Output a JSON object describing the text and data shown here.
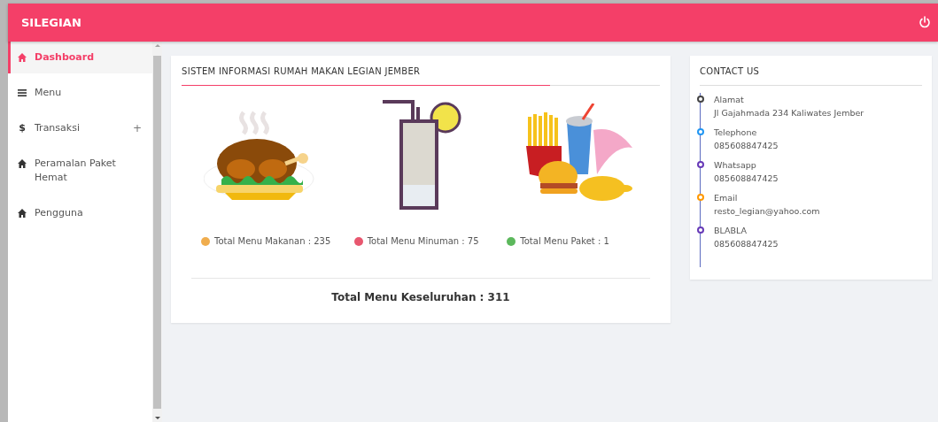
{
  "header": {
    "title": "SILEGIAN"
  },
  "sidebar": {
    "items": [
      {
        "label": "Dashboard",
        "kind": "home",
        "selected": true
      },
      {
        "label": "Menu",
        "kind": "bars",
        "selected": false
      },
      {
        "label": "Transaksi",
        "kind": "symbol",
        "symbol": "$",
        "selected": false,
        "expand_mark": "+"
      },
      {
        "label": "Peramalan Paket Hemat",
        "kind": "home",
        "selected": false
      },
      {
        "label": "Pengguna",
        "kind": "home",
        "selected": false
      }
    ]
  },
  "dashboard": {
    "title": "SISTEM INFORMASI RUMAH MAKAN LEGIAN JEMBER",
    "stats": [
      {
        "kind": "food",
        "label": "Total Menu Makanan : 235",
        "color": "#f0ad4e"
      },
      {
        "kind": "drink",
        "label": "Total Menu Minuman : 75",
        "color": "#e8576f"
      },
      {
        "kind": "package",
        "label": "Total Menu Paket : 1",
        "color": "#5cb85c"
      }
    ],
    "total": "Total Menu Keseluruhan : 311"
  },
  "contact": {
    "title": "CONTACT US",
    "items": [
      {
        "label": "Alamat",
        "value": "Jl Gajahmada 234 Kaliwates Jember",
        "color": "#444444"
      },
      {
        "label": "Telephone",
        "value": "085608847425",
        "color": "#2196f3"
      },
      {
        "label": "Whatsapp",
        "value": "085608847425",
        "color": "#673ab7"
      },
      {
        "label": "Email",
        "value": "resto_legian@yahoo.com",
        "color": "#ff9800"
      },
      {
        "label": "BLABLA",
        "value": "085608847425",
        "color": "#673ab7"
      }
    ]
  }
}
